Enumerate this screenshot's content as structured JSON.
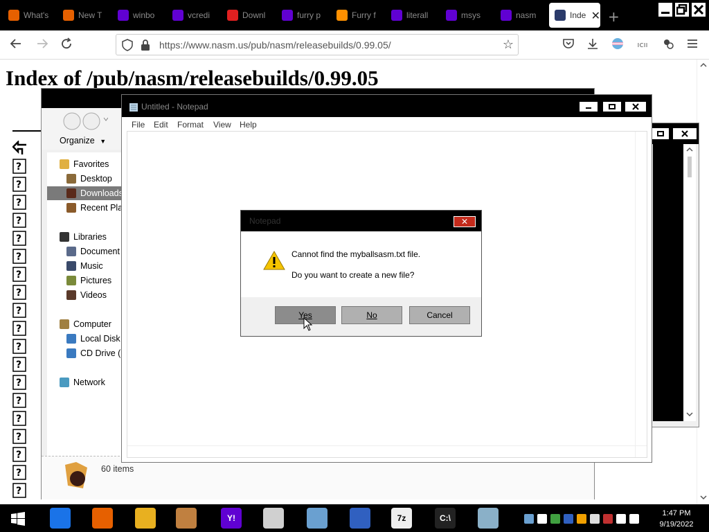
{
  "browser": {
    "tabs": [
      {
        "title": "What's",
        "favicon": "firefox-icon",
        "color": "#e66000"
      },
      {
        "title": "New T",
        "favicon": "firefox-icon",
        "color": "#e66000"
      },
      {
        "title": "winbo",
        "favicon": "yahoo-icon",
        "color": "#6001d2"
      },
      {
        "title": "vcredi",
        "favicon": "yahoo-icon",
        "color": "#6001d2"
      },
      {
        "title": "Downl",
        "favicon": "power-icon",
        "color": "#e02020"
      },
      {
        "title": "furry p",
        "favicon": "yahoo-icon",
        "color": "#6001d2"
      },
      {
        "title": "Furry f",
        "favicon": "ph-icon",
        "color": "#ff9000"
      },
      {
        "title": "literall",
        "favicon": "yahoo-icon",
        "color": "#6001d2"
      },
      {
        "title": "msys",
        "favicon": "yahoo-icon",
        "color": "#6001d2"
      },
      {
        "title": "nasm",
        "favicon": "yahoo-icon",
        "color": "#6001d2"
      },
      {
        "title": "Inde",
        "favicon": "nasm-icon",
        "color": "#2a3a6a",
        "active": true
      }
    ],
    "new_tab": "+",
    "url": "https://www.nasm.us/pub/nasm/releasebuilds/0.99.05/"
  },
  "page": {
    "title": "Index of /pub/nasm/releasebuilds/0.99.05"
  },
  "explorer": {
    "organize_label": "Organize",
    "nav": [
      {
        "label": "Favorites",
        "icon": "star-icon",
        "color": "#e0b040",
        "indent": 0
      },
      {
        "label": "Desktop",
        "icon": "desktop-icon",
        "color": "#8a6a3a",
        "indent": 1
      },
      {
        "label": "Downloads",
        "icon": "downloads-icon",
        "color": "#5a2a1a",
        "indent": 1,
        "selected": true
      },
      {
        "label": "Recent Pla",
        "icon": "recent-icon",
        "color": "#8a5a2a",
        "indent": 1
      },
      {
        "label": "Libraries",
        "icon": "libraries-icon",
        "color": "#333333",
        "indent": 0
      },
      {
        "label": "Document",
        "icon": "documents-icon",
        "color": "#5a6a8a",
        "indent": 1
      },
      {
        "label": "Music",
        "icon": "music-icon",
        "color": "#3a4a6a",
        "indent": 1
      },
      {
        "label": "Pictures",
        "icon": "pictures-icon",
        "color": "#7a8a3a",
        "indent": 1
      },
      {
        "label": "Videos",
        "icon": "videos-icon",
        "color": "#5a3a2a",
        "indent": 1
      },
      {
        "label": "Computer",
        "icon": "computer-icon",
        "color": "#a08040",
        "indent": 0
      },
      {
        "label": "Local Disk",
        "icon": "disk-icon",
        "color": "#3a7ac0",
        "indent": 1
      },
      {
        "label": "CD Drive (E",
        "icon": "cd-drive-icon",
        "color": "#3a7ac0",
        "indent": 1
      },
      {
        "label": "Network",
        "icon": "network-icon",
        "color": "#4a9ac0",
        "indent": 0
      }
    ],
    "item_count": "60 items"
  },
  "notepad": {
    "title": "Untitled - Notepad",
    "menu": [
      "File",
      "Edit",
      "Format",
      "View",
      "Help"
    ]
  },
  "dialog": {
    "title": "Notepad",
    "line1": "Cannot find the myballsasm.txt file.",
    "line2": "Do you want to create a new file?",
    "yes": "Yes",
    "no": "No",
    "cancel": "Cancel",
    "close_glyph": "✕"
  },
  "taskbar": {
    "time": "1:47 PM",
    "date": "9/19/2022",
    "apps": [
      {
        "name": "chrome-icon",
        "color": "#1a73e8",
        "glyph": ""
      },
      {
        "name": "firefox-icon",
        "color": "#e66000",
        "glyph": ""
      },
      {
        "name": "file-explorer-icon",
        "color": "#e8b020",
        "glyph": ""
      },
      {
        "name": "paint-icon",
        "color": "#c08040",
        "glyph": ""
      },
      {
        "name": "yahoo-messenger-icon",
        "color": "#6001d2",
        "glyph": "Y!"
      },
      {
        "name": "mixer-icon",
        "color": "#d0d0d0",
        "glyph": ""
      },
      {
        "name": "monitor-icon",
        "color": "#6aa0d0",
        "glyph": ""
      },
      {
        "name": "network-tool-icon",
        "color": "#3060c0",
        "glyph": ""
      },
      {
        "name": "7zip-icon",
        "color": "#eeeeee",
        "glyph": "7z"
      },
      {
        "name": "cmd-icon",
        "color": "#222222",
        "glyph": "C:\\"
      },
      {
        "name": "notepad-icon",
        "color": "#8ab0c8",
        "glyph": ""
      }
    ]
  }
}
